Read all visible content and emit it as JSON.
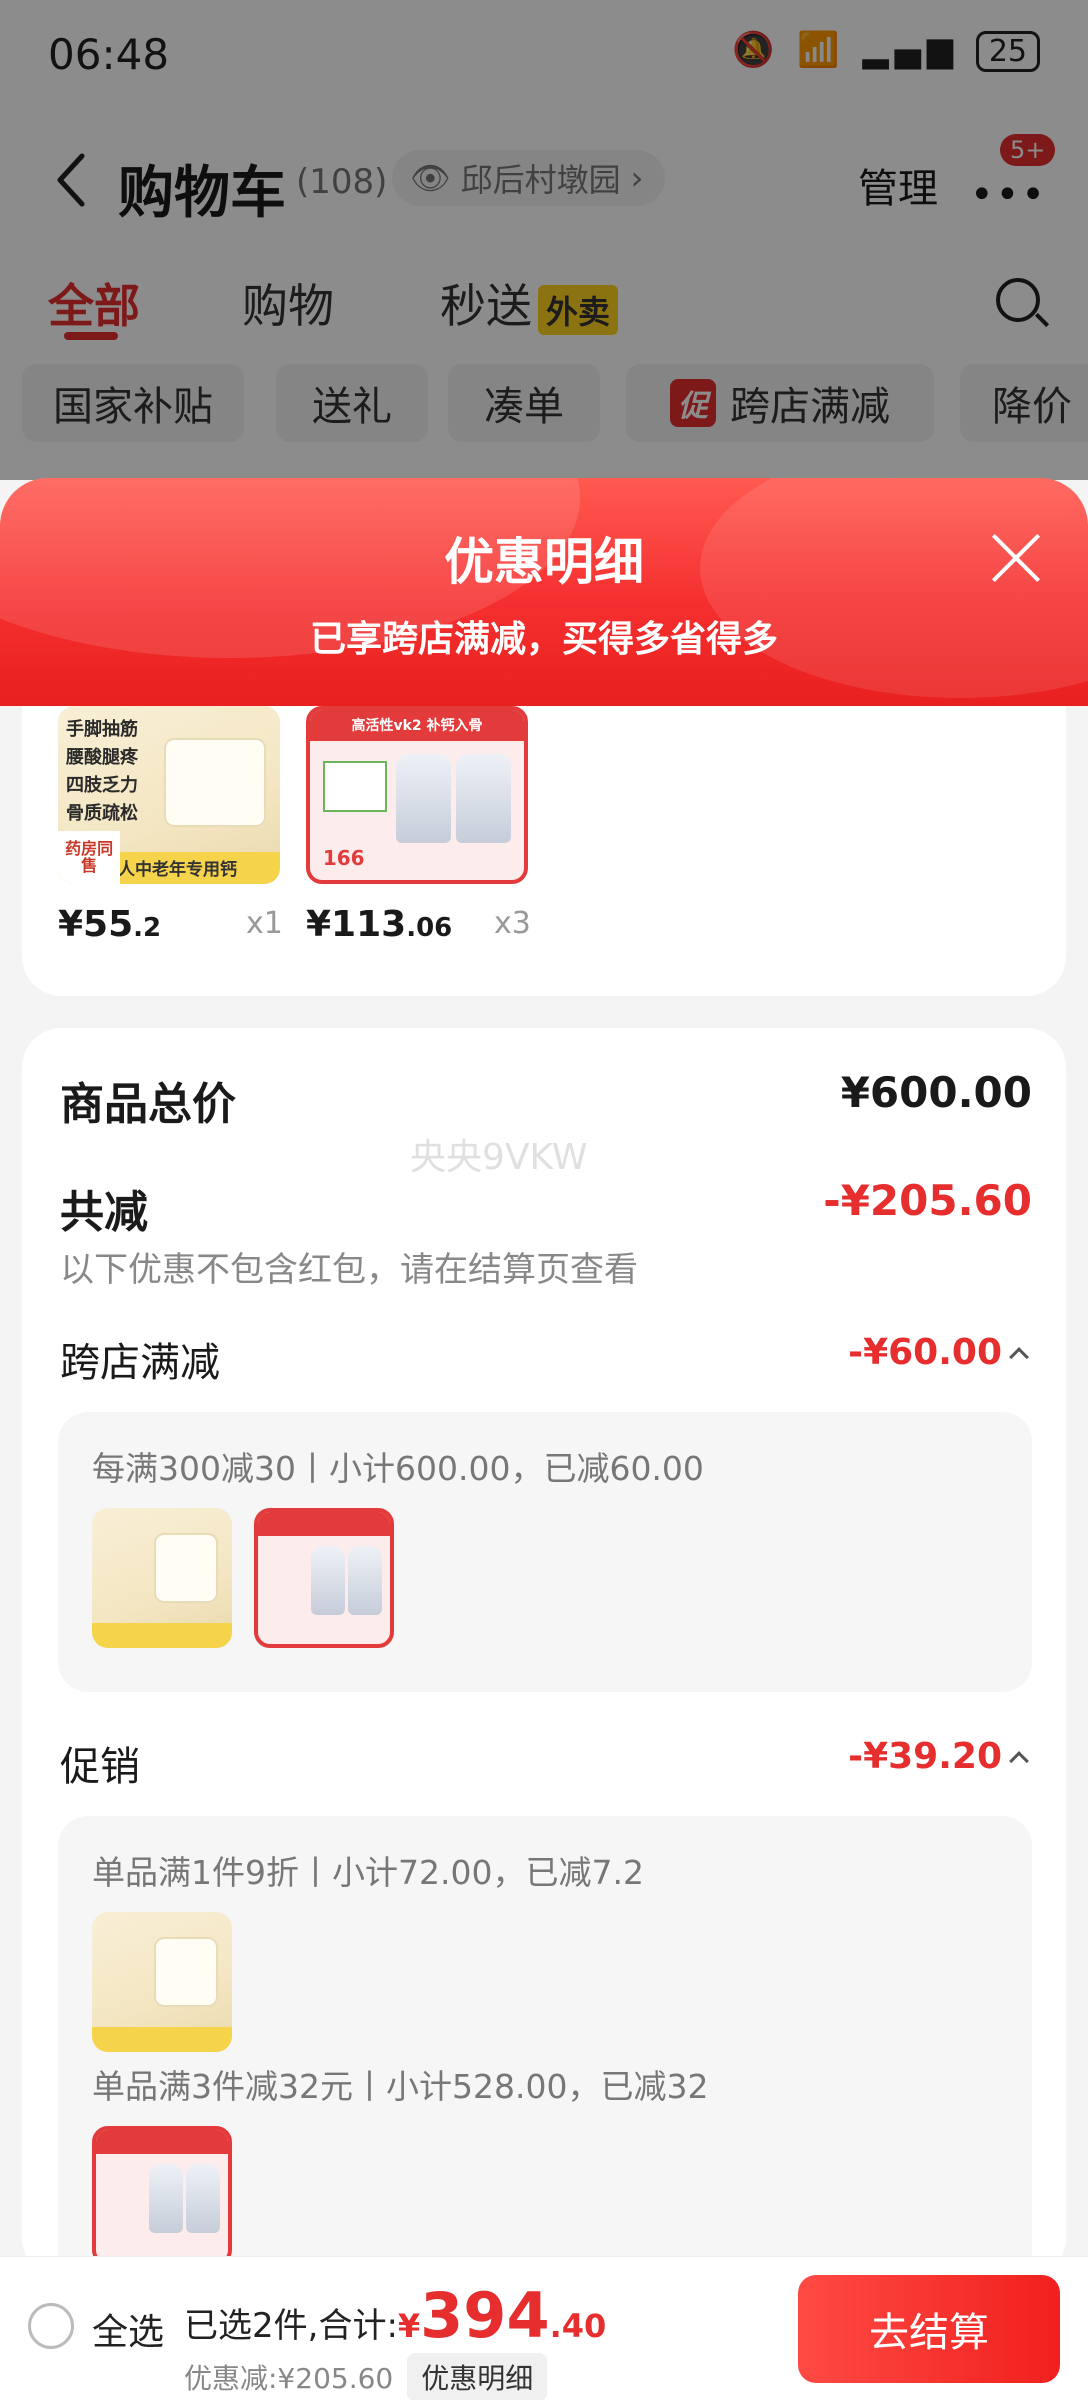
{
  "status_bar": {
    "time": "06:48",
    "battery": "25"
  },
  "nav": {
    "title": "购物车",
    "count": "(108)",
    "location": "邱后村墩园",
    "manage": "管理",
    "badge": "5+"
  },
  "tabs": [
    {
      "label": "全部"
    },
    {
      "label": "购物"
    },
    {
      "label": "秒送",
      "tag": "外卖"
    }
  ],
  "filters": [
    {
      "label": "国家补贴"
    },
    {
      "label": "送礼"
    },
    {
      "label": "凑单"
    },
    {
      "label": "跨店满减",
      "tag": "促"
    },
    {
      "label": "降价"
    }
  ],
  "sheet": {
    "title": "优惠明细",
    "subtitle": "已享跨店满减，买得多省得多"
  },
  "products": [
    {
      "price_int": "¥55",
      "price_dec": ".2",
      "qty": "x1",
      "thumb_lines": [
        "手脚抽筋",
        "腰酸腿疼",
        "四肢乏力",
        "骨质疏松"
      ],
      "thumb_foot": "成人中老年专用钙",
      "thumb_pharm": "药房同售"
    },
    {
      "price_int": "¥113",
      "price_dec": ".06",
      "qty": "x3",
      "thumb_head": "高活性vk2 补钙入骨",
      "thumb_price": "166"
    }
  ],
  "summary": {
    "total_label": "商品总价",
    "total_value": "¥600.00",
    "watermark": "央央9VKW",
    "reduce_label": "共减",
    "reduce_value": "-¥205.60",
    "reduce_hint": "以下优惠不包含红包，请在结算页查看"
  },
  "sections": {
    "cross_store": {
      "label": "跨店满减",
      "value": "-¥60.00",
      "rule": "每满300减30丨小计600.00，已减60.00"
    },
    "promo": {
      "label": "促销",
      "value": "-¥39.20",
      "rule1": "单品满1件9折丨小计72.00，已减7.2",
      "rule2": "单品满3件减32元丨小计528.00，已减32"
    }
  },
  "bottom": {
    "select_all": "全选",
    "selected_prefix": "已选2件,合计:",
    "yen": "¥",
    "total_int": "394",
    "total_dec": ".40",
    "discount": "优惠减:¥205.60",
    "detail_button": "优惠明细",
    "checkout": "去结算"
  },
  "colors": {
    "accent": "#e62e2e",
    "header_gradient_top": "#ff5a50",
    "header_gradient_bottom": "#e8201f"
  }
}
